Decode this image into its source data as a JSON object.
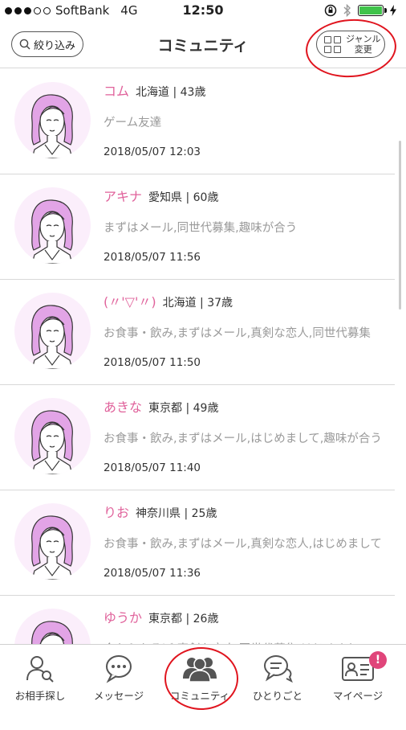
{
  "status_bar": {
    "carrier": "SoftBank",
    "network": "4G",
    "time": "12:50",
    "signal_bars": 3,
    "battery_level": 1.0,
    "battery_color": "#3fc34a"
  },
  "nav": {
    "filter_label": "絞り込み",
    "title": "コミュニティ",
    "genre_line1": "ジャンル",
    "genre_line2": "変更"
  },
  "colors": {
    "accent_pink": "#e0629b",
    "highlight_red": "#e0141e",
    "badge": "#e0457a"
  },
  "posts": [
    {
      "name": "コム",
      "prefecture": "北海道",
      "age": "43歳",
      "message": "ゲーム友達",
      "date": "2018/05/07 12:03"
    },
    {
      "name": "アキナ",
      "prefecture": "愛知県",
      "age": "60歳",
      "message": "まずはメール,同世代募集,趣味が合う",
      "date": "2018/05/07 11:56"
    },
    {
      "name": "(〃'▽'〃)",
      "prefecture": "北海道",
      "age": "37歳",
      "message": "お食事・飲み,まずはメール,真剣な恋人,同世代募集",
      "date": "2018/05/07 11:50"
    },
    {
      "name": "あきな",
      "prefecture": "東京都",
      "age": "49歳",
      "message": "お食事・飲み,まずはメール,はじめまして,趣味が合う",
      "date": "2018/05/07 11:40"
    },
    {
      "name": "りお",
      "prefecture": "神奈川県",
      "age": "25歳",
      "message": "お食事・飲み,まずはメール,真剣な恋人,はじめまして",
      "date": "2018/05/07 11:36"
    },
    {
      "name": "ゆうか",
      "prefecture": "東京都",
      "age": "26歳",
      "message": "今からあそぼ,真剣な恋人,同世代募集,はじめまして",
      "date": ""
    }
  ],
  "tabs": [
    {
      "label": "お相手探し",
      "icon": "search-person-icon"
    },
    {
      "label": "メッセージ",
      "icon": "speech-bubble-icon"
    },
    {
      "label": "コミュニティ",
      "icon": "group-icon",
      "active": true
    },
    {
      "label": "ひとりごと",
      "icon": "chat-bubble-icon"
    },
    {
      "label": "マイページ",
      "icon": "id-card-icon",
      "badge": "!"
    }
  ]
}
